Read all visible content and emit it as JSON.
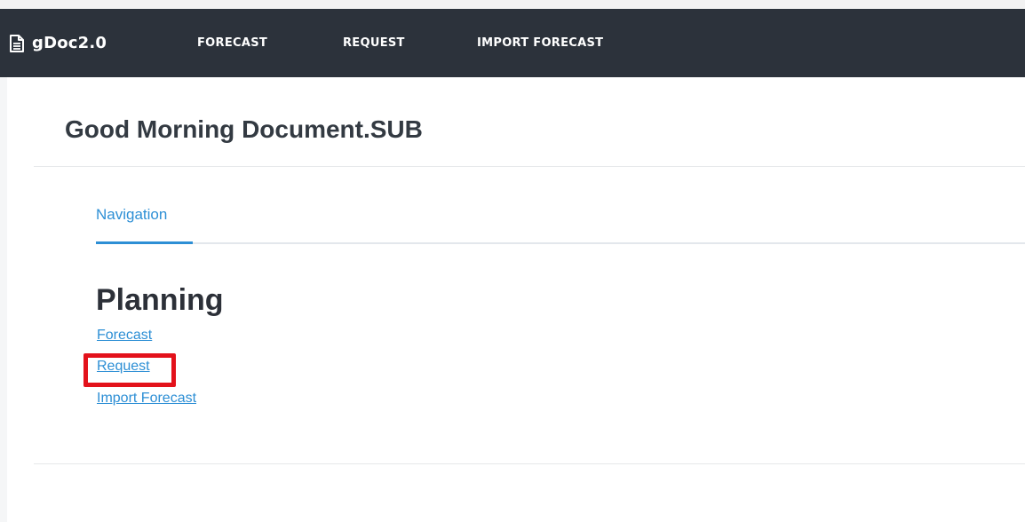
{
  "navbar": {
    "brand": "gDoc2.0",
    "brand_icon": "document-icon",
    "links": [
      "FORECAST",
      "REQUEST",
      "IMPORT FORECAST"
    ]
  },
  "greeting": "Good Morning Document.SUB",
  "tabs": {
    "active": "Navigation"
  },
  "section": {
    "title": "Planning",
    "links": [
      "Forecast",
      "Request",
      "Import Forecast"
    ]
  },
  "colors": {
    "navbar_bg": "#2c323b",
    "link": "#2d8fd5",
    "highlight": "#e3121b"
  }
}
